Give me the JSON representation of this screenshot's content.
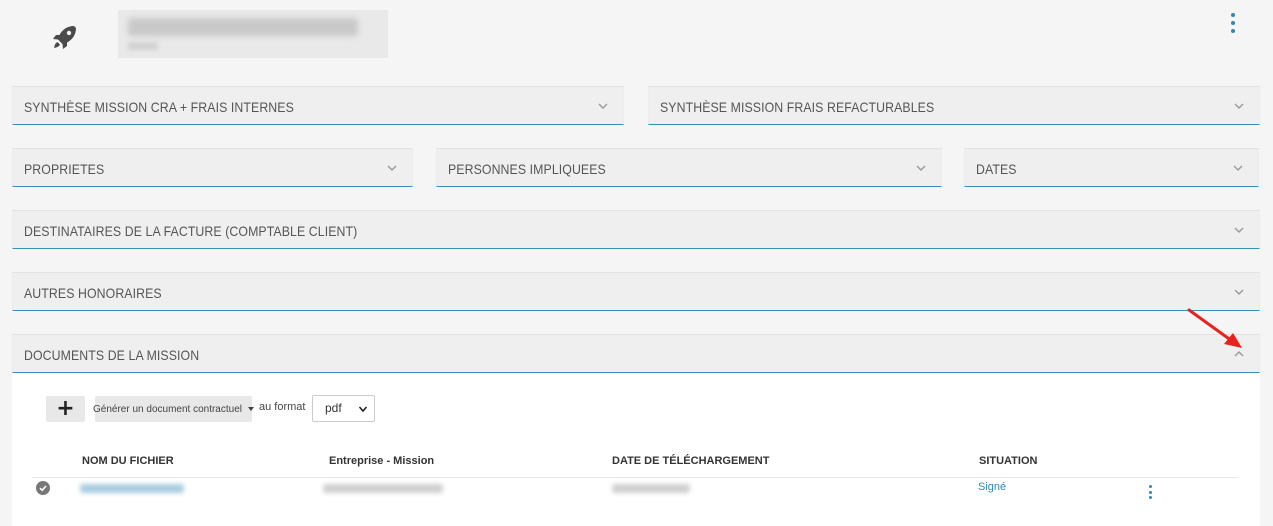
{
  "panels": {
    "synthese_cra": "SYNTHÈSE MISSION CRA + FRAIS INTERNES",
    "synthese_frais": "SYNTHÈSE MISSION FRAIS REFACTURABLES",
    "proprietes": "PROPRIETES",
    "personnes": "PERSONNES IMPLIQUEES",
    "dates": "DATES",
    "destinataires": "DESTINATAIRES DE LA FACTURE (COMPTABLE CLIENT)",
    "autres_honoraires": "AUTRES HONORAIRES",
    "documents": "DOCUMENTS DE LA MISSION"
  },
  "documents": {
    "add_label": "+",
    "generate_label": "Générer un document contractuel",
    "format_label": "au format",
    "format_value": "pdf",
    "columns": {
      "filename": "NOM DU FICHIER",
      "company": "Entreprise - Mission",
      "upload_date": "DATE DE TÉLÉCHARGEMENT",
      "status": "SITUATION"
    },
    "rows": [
      {
        "status": "Signé"
      }
    ]
  },
  "icons": {
    "header": "rocket-icon",
    "menu": "kebab-menu-icon",
    "expand": "chevron-down-icon",
    "collapse": "chevron-up-icon",
    "row_status": "check-circle-icon",
    "annotation": "red-arrow-icon"
  },
  "colors": {
    "accent": "#2a8bb5",
    "panel_border": "#3790b8",
    "annotation": "#e8231f"
  }
}
